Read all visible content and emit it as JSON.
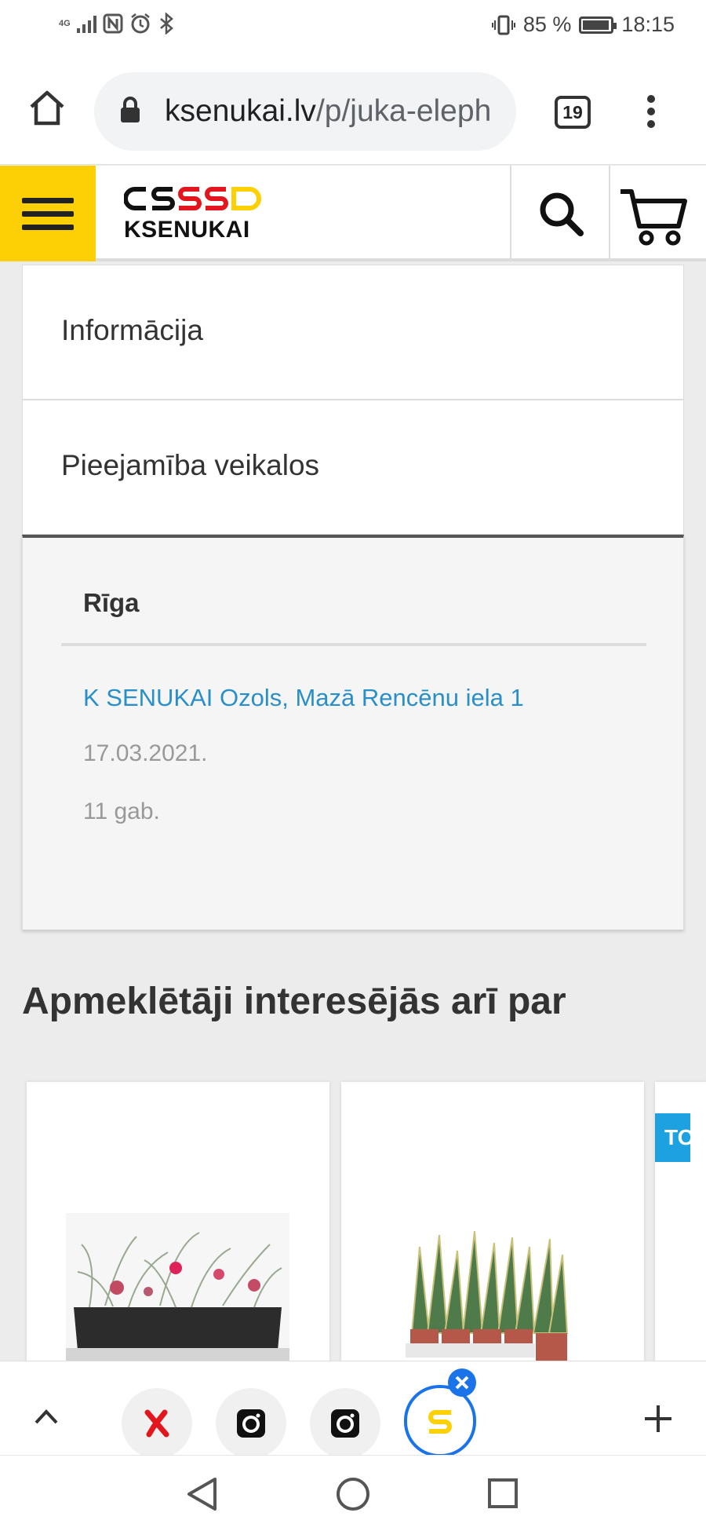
{
  "status_bar": {
    "network": "4G",
    "battery_percent": "85 %",
    "battery_level": 0.85,
    "time": "18:15"
  },
  "browser": {
    "url_domain": "ksenukai.lv",
    "url_path": "/p/juka-eleph",
    "tab_count": "19"
  },
  "site": {
    "logo_text": "KSENUKAI"
  },
  "sections": [
    {
      "label": "Informācija"
    },
    {
      "label": "Pieejamība veikalos"
    }
  ],
  "availability": {
    "city": "Rīga",
    "store_name": "K SENUKAI Ozols, Mazā Rencēnu iela 1",
    "date": "17.03.2021.",
    "quantity": "11 gab."
  },
  "recommendations": {
    "heading": "Apmeklētāji interesējās arī par",
    "badge": "TO"
  },
  "colors": {
    "brand_yellow": "#fcd004",
    "link_blue": "#2a8fc9",
    "badge_blue": "#1da1e0"
  }
}
